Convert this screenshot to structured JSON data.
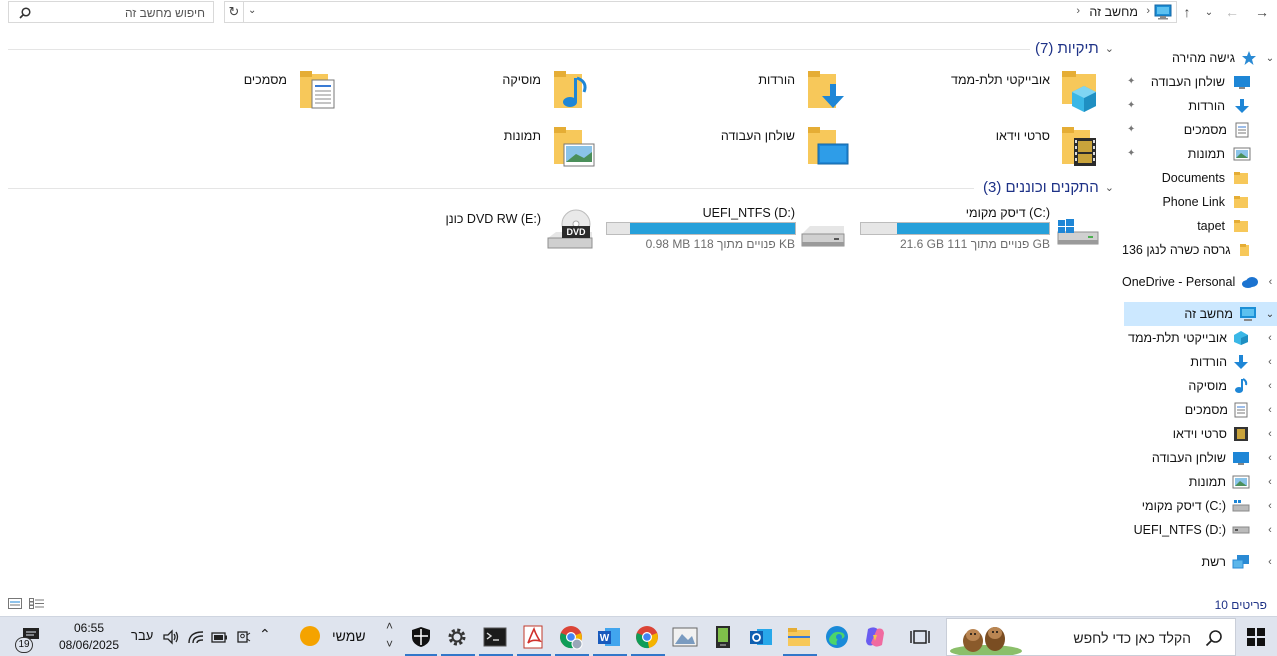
{
  "address": {
    "breadcrumb": [
      "מחשב זה"
    ],
    "search_placeholder": "חיפוש מחשב זה"
  },
  "nav": {
    "quick_access": "גישה מהירה",
    "pinned": [
      "שולחן העבודה",
      "הורדות",
      "מסמכים",
      "תמונות"
    ],
    "folders": [
      "Documents",
      "Phone Link",
      "tapet",
      "גרסה כשרה לנגן 136"
    ],
    "onedrive": "OneDrive - Personal",
    "this_pc": "מחשב זה",
    "pc_children": [
      "אובייקטי תלת-ממד",
      "הורדות",
      "מוסיקה",
      "מסמכים",
      "סרטי וידאו",
      "שולחן העבודה",
      "תמונות",
      "דיסק מקומי (C:)",
      "UEFI_NTFS (D:)"
    ],
    "network": "רשת"
  },
  "folders_section": {
    "title": "תיקיות (7)",
    "items": [
      "אובייקטי תלת-ממד",
      "הורדות",
      "מוסיקה",
      "מסמכים",
      "סרטי וידאו",
      "שולחן העבודה",
      "תמונות"
    ]
  },
  "drives_section": {
    "title": "התקנים וכוננים (3)",
    "drives": [
      {
        "name": "דיסק מקומי (C:)",
        "free_text": "21.6 GB פנויים מתוך 111 GB",
        "used_fraction": 0.81
      },
      {
        "name": "UEFI_NTFS (D:)",
        "free_text": "0.98 MB פנויים מתוך 118 KB",
        "used_fraction": 0.88
      },
      {
        "name": "כונן DVD RW (E:)",
        "badge": "DVD"
      }
    ]
  },
  "status": {
    "items_count": "10 פריטים"
  },
  "taskbar": {
    "search_placeholder": "הקלד כאן כדי לחפש",
    "weather": "שמשי",
    "language": "עבר",
    "time": "06:55",
    "date": "08/06/2025",
    "notification_count": "19"
  },
  "colors": {
    "accent": "#26a0da",
    "header_blue": "#1e3287",
    "folder_yellow": "#f7c85a",
    "selected_bg": "#cce8ff",
    "taskbar_bg": "#dfe4ee"
  }
}
